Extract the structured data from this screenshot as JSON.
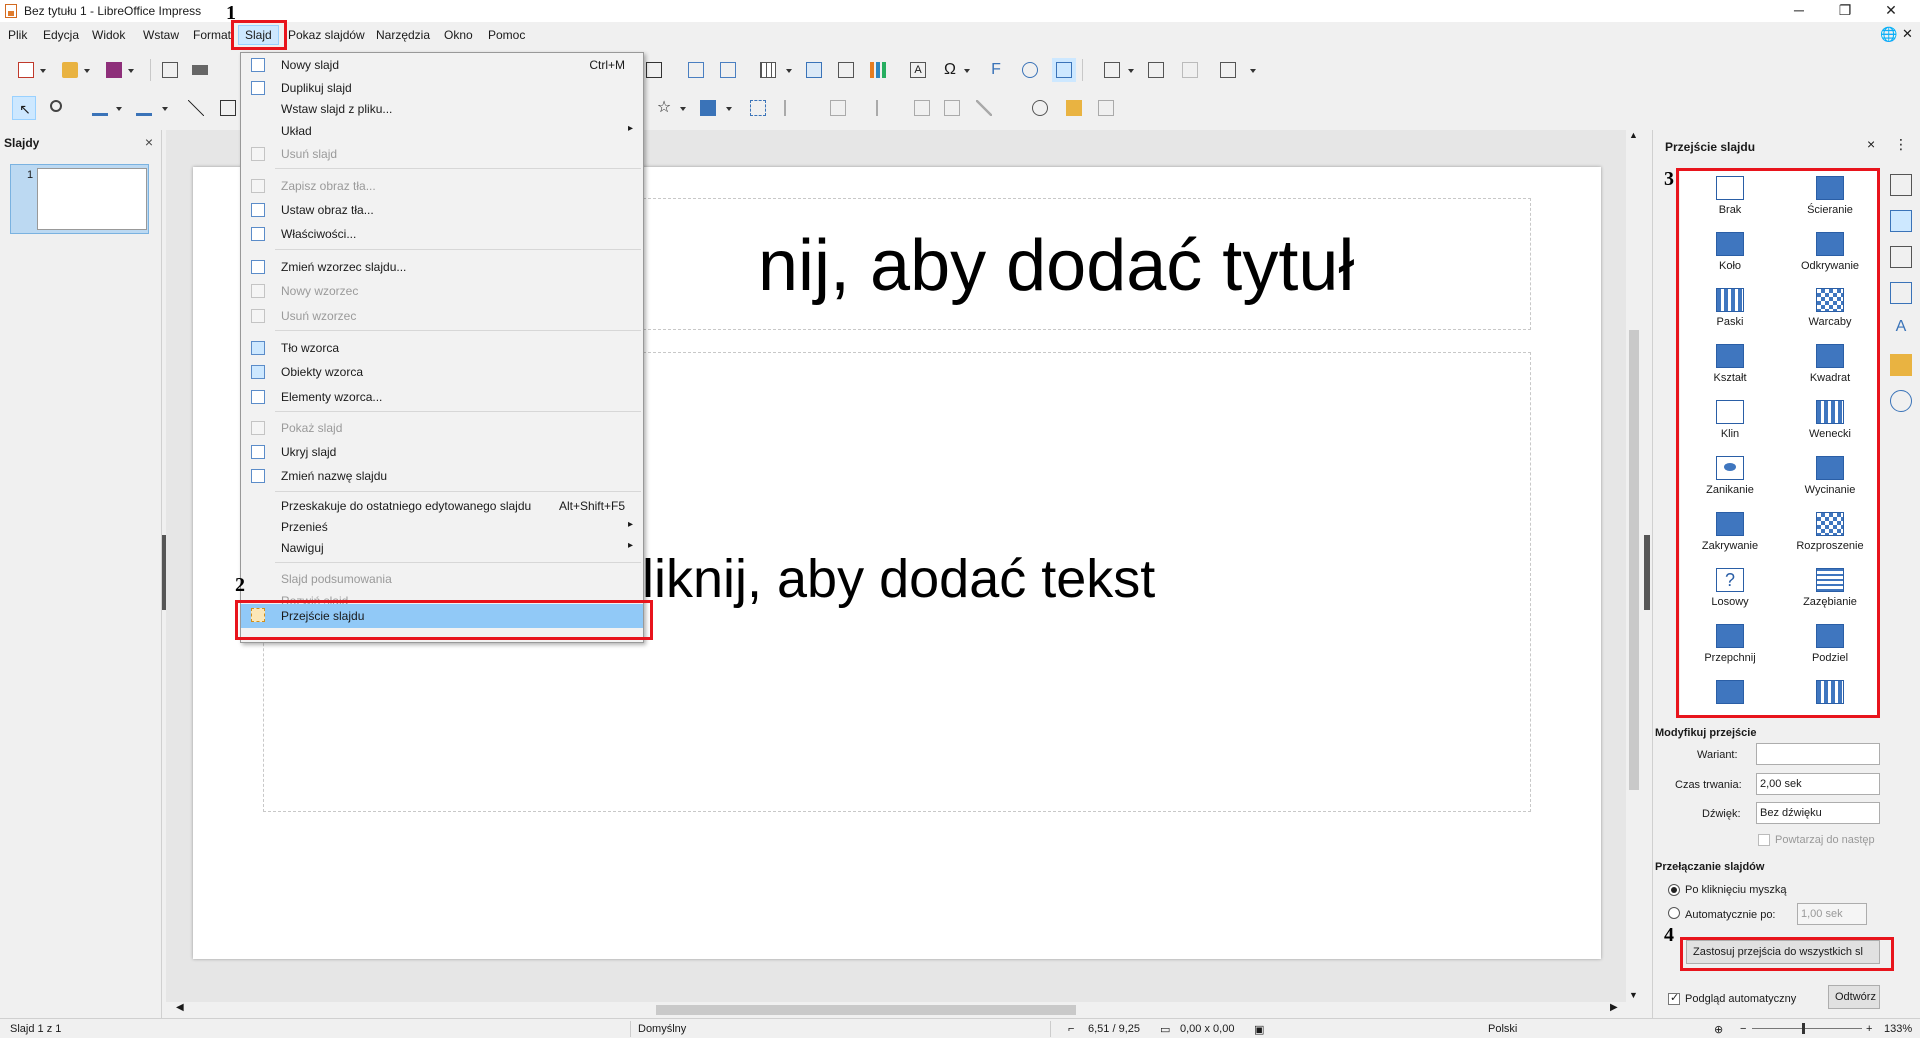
{
  "window": {
    "title": "Bez tytułu 1 - LibreOffice Impress"
  },
  "menubar": [
    {
      "label": "Plik"
    },
    {
      "label": "Edycja"
    },
    {
      "label": "Widok"
    },
    {
      "label": "Wstaw"
    },
    {
      "label": "Format"
    },
    {
      "label": "Slajd"
    },
    {
      "label": "Pokaz slajdów"
    },
    {
      "label": "Narzędzia"
    },
    {
      "label": "Okno"
    },
    {
      "label": "Pomoc"
    }
  ],
  "slides_pane": {
    "header": "Slajdy",
    "close": "×",
    "slide_number": "1"
  },
  "slide": {
    "title_placeholder": "nij, aby dodać tytuł",
    "body_placeholder": "liknij, aby dodać tekst"
  },
  "slide_menu": {
    "items": [
      {
        "label": "Nowy slajd",
        "shortcut": "Ctrl+M",
        "disabled": false
      },
      {
        "label": "Duplikuj slajd",
        "disabled": false
      },
      {
        "label": "Wstaw slajd z pliku...",
        "disabled": false
      },
      {
        "label": "Układ",
        "submenu": true,
        "disabled": false
      },
      {
        "label": "Usuń slajd",
        "disabled": true
      },
      {
        "label": "Zapisz obraz tła...",
        "disabled": true
      },
      {
        "label": "Ustaw obraz tła...",
        "disabled": false
      },
      {
        "label": "Właściwości...",
        "disabled": false
      },
      {
        "label": "Zmień wzorzec slajdu...",
        "disabled": false
      },
      {
        "label": "Nowy wzorzec",
        "disabled": true
      },
      {
        "label": "Usuń wzorzec",
        "disabled": true
      },
      {
        "label": "Tło wzorca",
        "disabled": false
      },
      {
        "label": "Obiekty wzorca",
        "disabled": false
      },
      {
        "label": "Elementy wzorca...",
        "disabled": false
      },
      {
        "label": "Pokaż slajd",
        "disabled": true
      },
      {
        "label": "Ukryj slajd",
        "disabled": false
      },
      {
        "label": "Zmień nazwę slajdu",
        "disabled": false
      },
      {
        "label": "Przeskakuje do ostatniego edytowanego slajdu",
        "shortcut": "Alt+Shift+F5",
        "disabled": false
      },
      {
        "label": "Przenieś",
        "submenu": true,
        "disabled": false
      },
      {
        "label": "Nawiguj",
        "submenu": true,
        "disabled": false
      },
      {
        "label": "Slajd podsumowania",
        "disabled": true
      },
      {
        "label": "Rozwiń slajd",
        "disabled": true
      },
      {
        "label": "Przejście slajdu",
        "disabled": false,
        "highlighted": true
      }
    ]
  },
  "sidebar": {
    "header": "Przejście slajdu",
    "close": "×",
    "transitions": [
      "Brak",
      "Ścieranie",
      "Koło",
      "Odkrywanie",
      "Paski",
      "Warcaby",
      "Kształt",
      "Kwadrat",
      "Klin",
      "Wenecki",
      "Zanikanie",
      "Wycinanie",
      "Zakrywanie",
      "Rozproszenie",
      "Losowy",
      "Zazębianie",
      "Przepchnij",
      "Podziel"
    ],
    "modify_header": "Modyfikuj przejście",
    "variant_label": "Wariant:",
    "variant_value": "",
    "duration_label": "Czas trwania:",
    "duration_value": "2,00 sek",
    "sound_label": "Dźwięk:",
    "sound_value": "Bez dźwięku",
    "repeat_label": "Powtarzaj do następ",
    "advance_header": "Przełączanie slajdów",
    "on_click_label": "Po kliknięciu myszką",
    "auto_label": "Automatycznie po:",
    "auto_value": "1,00 sek",
    "apply_all": "Zastosuj przejścia do wszystkich sl",
    "auto_preview": "Podgląd automatyczny",
    "play": "Odtwórz"
  },
  "statusbar": {
    "slide_info": "Slajd 1 z 1",
    "master": "Domyślny",
    "position": "6,51 / 9,25",
    "size": "0,00 x 0,00",
    "language": "Polski",
    "zoom": "133%"
  },
  "annotations": {
    "step1": "1",
    "step2": "2",
    "step3": "3",
    "step4": "4"
  },
  "colors": {
    "highlight": "#91c9f7",
    "annotation_red": "#e8141c",
    "accent_blue": "#3f76bf"
  }
}
